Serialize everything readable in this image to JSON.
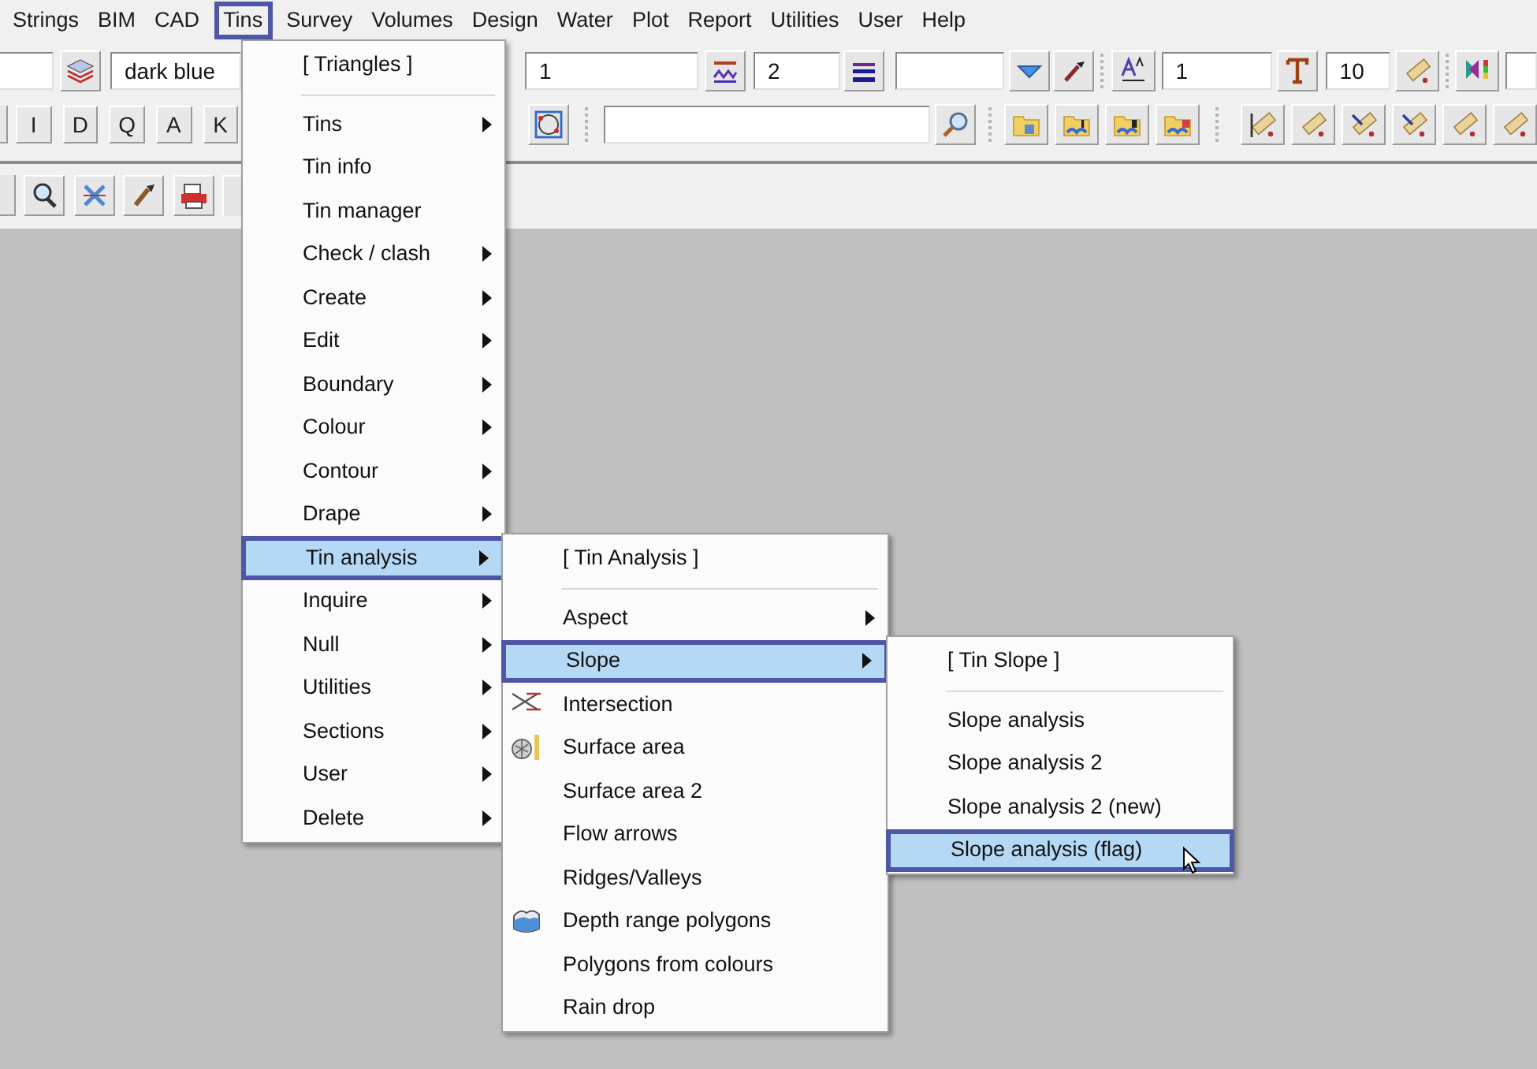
{
  "menu_bar": [
    {
      "label": "Strings",
      "selected": false
    },
    {
      "label": "BIM",
      "selected": false
    },
    {
      "label": "CAD",
      "selected": false
    },
    {
      "label": "Tins",
      "selected": true
    },
    {
      "label": "Survey",
      "selected": false
    },
    {
      "label": "Volumes",
      "selected": false
    },
    {
      "label": "Design",
      "selected": false
    },
    {
      "label": "Water",
      "selected": false
    },
    {
      "label": "Plot",
      "selected": false
    },
    {
      "label": "Report",
      "selected": false
    },
    {
      "label": "Utilities",
      "selected": false
    },
    {
      "label": "User",
      "selected": false
    },
    {
      "label": "Help",
      "selected": false
    }
  ],
  "toolbar_1": {
    "fields": [
      "dark blue",
      "1",
      "2",
      "1",
      "10"
    ]
  },
  "toolbar_2": {
    "letter_buttons": [
      "I",
      "D",
      "Q",
      "A",
      "K"
    ]
  },
  "tins_menu": [
    {
      "kind": "header",
      "label": "[ Triangles ]"
    },
    {
      "kind": "separator"
    },
    {
      "kind": "item",
      "label": "Tins",
      "submenu": true,
      "selected": false
    },
    {
      "kind": "item",
      "label": "Tin info",
      "submenu": false,
      "selected": false
    },
    {
      "kind": "item",
      "label": "Tin manager",
      "submenu": false,
      "selected": false
    },
    {
      "kind": "item",
      "label": "Check / clash",
      "submenu": true,
      "selected": false
    },
    {
      "kind": "item",
      "label": "Create",
      "submenu": true,
      "selected": false
    },
    {
      "kind": "item",
      "label": "Edit",
      "submenu": true,
      "selected": false
    },
    {
      "kind": "item",
      "label": "Boundary",
      "submenu": true,
      "selected": false
    },
    {
      "kind": "item",
      "label": "Colour",
      "submenu": true,
      "selected": false
    },
    {
      "kind": "item",
      "label": "Contour",
      "submenu": true,
      "selected": false
    },
    {
      "kind": "item",
      "label": "Drape",
      "submenu": true,
      "selected": false
    },
    {
      "kind": "item",
      "label": "Tin analysis",
      "submenu": true,
      "selected": true
    },
    {
      "kind": "item",
      "label": "Inquire",
      "submenu": true,
      "selected": false
    },
    {
      "kind": "item",
      "label": "Null",
      "submenu": true,
      "selected": false
    },
    {
      "kind": "item",
      "label": "Utilities",
      "submenu": true,
      "selected": false
    },
    {
      "kind": "item",
      "label": "Sections",
      "submenu": true,
      "selected": false
    },
    {
      "kind": "item",
      "label": "User",
      "submenu": true,
      "selected": false
    },
    {
      "kind": "item",
      "label": "Delete",
      "submenu": true,
      "selected": false
    }
  ],
  "tin_analysis_menu": [
    {
      "kind": "header",
      "label": "[ Tin Analysis ]"
    },
    {
      "kind": "separator"
    },
    {
      "kind": "item",
      "label": "Aspect",
      "submenu": true,
      "selected": false
    },
    {
      "kind": "item",
      "label": "Slope",
      "submenu": true,
      "selected": true
    },
    {
      "kind": "item",
      "label": "Intersection",
      "submenu": false,
      "selected": false
    },
    {
      "kind": "item",
      "label": "Surface area",
      "submenu": false,
      "selected": false
    },
    {
      "kind": "item",
      "label": "Surface area 2",
      "submenu": false,
      "selected": false
    },
    {
      "kind": "item",
      "label": "Flow arrows",
      "submenu": false,
      "selected": false
    },
    {
      "kind": "item",
      "label": "Ridges/Valleys",
      "submenu": false,
      "selected": false
    },
    {
      "kind": "item",
      "label": "Depth range polygons",
      "submenu": false,
      "selected": false
    },
    {
      "kind": "item",
      "label": "Polygons from colours",
      "submenu": false,
      "selected": false
    },
    {
      "kind": "item",
      "label": "Rain drop",
      "submenu": false,
      "selected": false
    }
  ],
  "tin_slope_menu": [
    {
      "kind": "header",
      "label": "[ Tin Slope ]"
    },
    {
      "kind": "separator"
    },
    {
      "kind": "item",
      "label": "Slope analysis",
      "submenu": false,
      "selected": false
    },
    {
      "kind": "item",
      "label": "Slope analysis 2",
      "submenu": false,
      "selected": false
    },
    {
      "kind": "item",
      "label": "Slope analysis 2 (new)",
      "submenu": false,
      "selected": false
    },
    {
      "kind": "item",
      "label": "Slope analysis (flag)",
      "submenu": false,
      "selected": true
    }
  ]
}
